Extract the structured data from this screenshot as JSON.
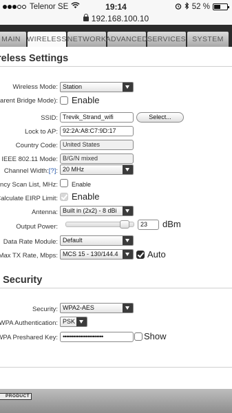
{
  "status": {
    "carrier": "Telenor SE",
    "time": "19:14",
    "battery": "52 %"
  },
  "browser": {
    "url": "192.168.100.10"
  },
  "tabs": [
    {
      "label": "MAIN"
    },
    {
      "label": "WIRELESS"
    },
    {
      "label": "NETWORK"
    },
    {
      "label": "ADVANCED"
    },
    {
      "label": "SERVICES"
    },
    {
      "label": "SYSTEM"
    }
  ],
  "wireless": {
    "title": "ireless Settings",
    "mode_label": "Wireless Mode:",
    "mode_value": "Station",
    "bridge_label": "nsparent Bridge Mode):",
    "bridge_text": "Enable",
    "ssid_label": "SSID:",
    "ssid_value": "Trevik_Strand_wifi",
    "select_button": "Select...",
    "lock_label": "Lock to AP:",
    "lock_value": "92:2A:A8:C7:9D:17",
    "country_label": "Country Code:",
    "country_value": "United States",
    "ieee_label": "IEEE 802.11 Mode:",
    "ieee_value": "B/G/N mixed",
    "channel_label": "Channel Width:",
    "channel_help": "[?]",
    "channel_value": "20 MHz",
    "freq_label": "quency Scan List, MHz:",
    "freq_text": "Enable",
    "eirp_label": "Calculate EIRP Limit:",
    "eirp_text": "Enable",
    "antenna_label": "Antenna:",
    "antenna_value": "Built in (2x2) - 8 dBi",
    "power_label": "Output Power:",
    "power_value": "23",
    "power_unit": "dBm",
    "power_level": 0.93,
    "rate_module_label": "Data Rate Module:",
    "rate_module_value": "Default",
    "max_tx_label": "Max TX Rate, Mbps:",
    "max_tx_value": "MCS 15 - 130/144.4",
    "auto_text": "Auto"
  },
  "security": {
    "title": "s Security",
    "security_label": "Security:",
    "security_value": "WPA2-AES",
    "wpa_auth_label": "WPA Authentication:",
    "wpa_auth_value": "PSK",
    "psk_label": "WPA Preshared Key:",
    "psk_value": "•••••••••••••••••••••••",
    "show_text": "Show"
  },
  "footer": {
    "logo_text": "PRODUCT"
  }
}
